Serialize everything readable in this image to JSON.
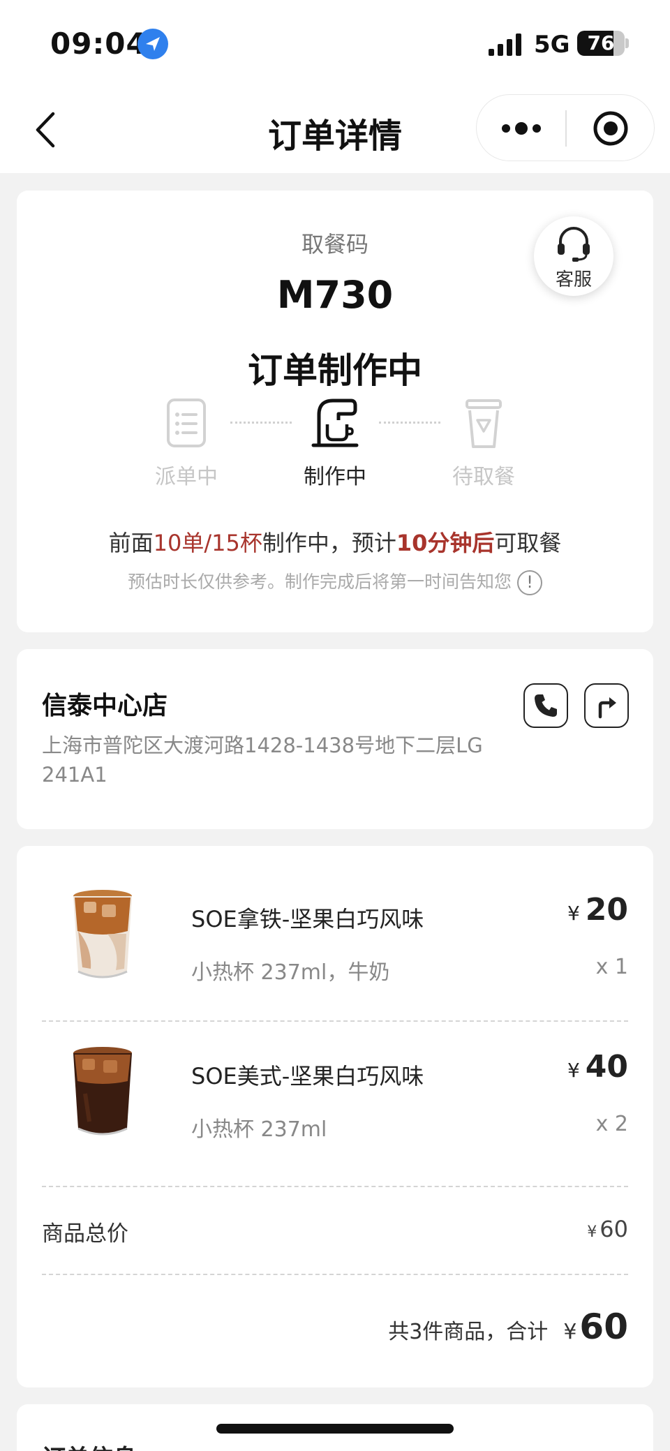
{
  "status_bar": {
    "time": "09:04",
    "network": "5G",
    "battery": "76",
    "battery_level": 0.76
  },
  "nav": {
    "title": "订单详情"
  },
  "order_status": {
    "pickup_label": "取餐码",
    "pickup_code": "M730",
    "status_text": "订单制作中",
    "service_label": "客服",
    "steps": [
      {
        "label": "派单中",
        "active": false
      },
      {
        "label": "制作中",
        "active": true
      },
      {
        "label": "待取餐",
        "active": false
      }
    ],
    "queue": {
      "prefix": "前面",
      "ahead": "10单/15杯",
      "middle": "制作中，预计",
      "eta": "10分钟后",
      "suffix": "可取餐"
    },
    "note": "预估时长仅供参考。制作完成后将第一时间告知您",
    "info_glyph": "!"
  },
  "store": {
    "name": "信泰中心店",
    "address": "上海市普陀区大渡河路1428-1438号地下二层LG 241A1"
  },
  "items": [
    {
      "name": "SOE拿铁-坚果白巧风味",
      "spec": "小热杯 237ml，牛奶",
      "currency": "¥",
      "price": "20",
      "qty": "x 1"
    },
    {
      "name": "SOE美式-坚果白巧风味",
      "spec": "小热杯 237ml",
      "currency": "¥",
      "price": "40",
      "qty": "x 2"
    }
  ],
  "summary": {
    "subtotal_label": "商品总价",
    "subtotal_currency": "¥",
    "subtotal_value": "60",
    "total_prefix": "共3件商品，合计",
    "total_currency": "¥",
    "total_value": "60"
  },
  "info_section": {
    "title": "订单信息"
  },
  "colors": {
    "accent_red": "#a8342c",
    "muted": "#c6c6c6",
    "location_blue": "#2f80ed"
  }
}
